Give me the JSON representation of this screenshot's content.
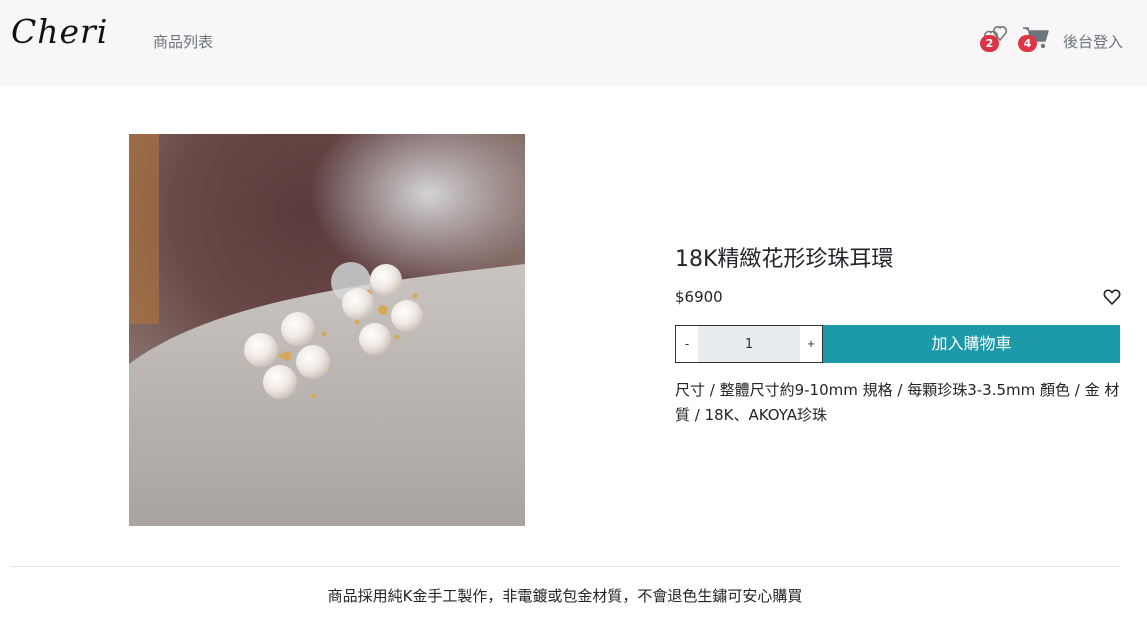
{
  "navbar": {
    "brand": "Cheri",
    "links": [
      {
        "label": "商品列表"
      }
    ],
    "favorites_count": "2",
    "cart_count": "4",
    "login_label": "後台登入"
  },
  "product": {
    "title": "18K精緻花形珍珠耳環",
    "price": "$6900",
    "quantity": "1",
    "minus_label": "-",
    "plus_label": "+",
    "add_to_cart_label": "加入購物車",
    "description": "尺寸 / 整體尺寸約9-10mm 規格 / 每顆珍珠3-3.5mm 顏色 / 金 材質 / 18K、AKOYA珍珠"
  },
  "footer": {
    "note": "商品採用純K金手工製作，非電鍍或包金材質，不會退色生鏽可安心購買"
  },
  "colors": {
    "navbar_bg": "#f8f6f6",
    "accent": "#1d9aaa",
    "badge": "#dc3545"
  },
  "icons": [
    "hearts-icon",
    "cart-icon",
    "heart-outline-icon"
  ]
}
